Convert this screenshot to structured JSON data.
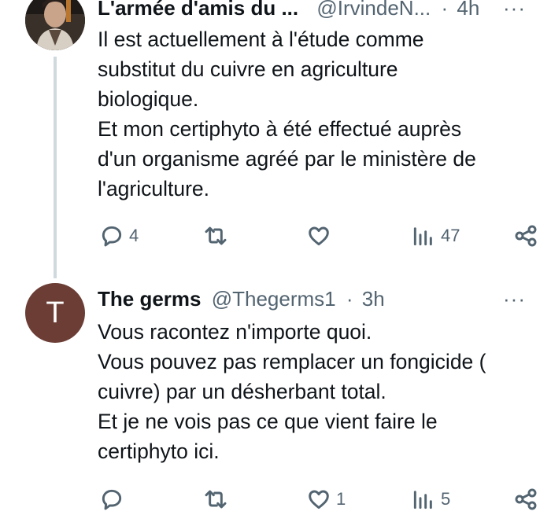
{
  "tweets": [
    {
      "author_name": "L'armée d'amis du ...",
      "handle": "@IrvindeN...",
      "separator": "·",
      "time": "4h",
      "more": "···",
      "text": "Il est actuellement à l'étude comme\nsubstitut du cuivre en agriculture\nbiologique.\nEt mon certiphyto à été effectué auprès\nd'un organisme agréé par le ministère de\nl'agriculture.",
      "replies": "4",
      "retweets": "",
      "likes": "",
      "views": "47"
    },
    {
      "avatar_letter": "T",
      "author_name": "The germs",
      "handle": "@Thegerms1",
      "separator": "·",
      "time": "3h",
      "more": "···",
      "text": "Vous racontez n'importe quoi.\nVous pouvez pas remplacer un fongicide (\ncuivre) par un désherbant total.\nEt je ne vois pas ce que vient faire le\ncertiphyto ici.",
      "replies": "",
      "retweets": "",
      "likes": "1",
      "views": "5"
    }
  ],
  "colors": {
    "text": "#0f1419",
    "secondary": "#536471",
    "thread_line": "#cfd9de",
    "avatar_letter_bg": "#6b3d35"
  }
}
